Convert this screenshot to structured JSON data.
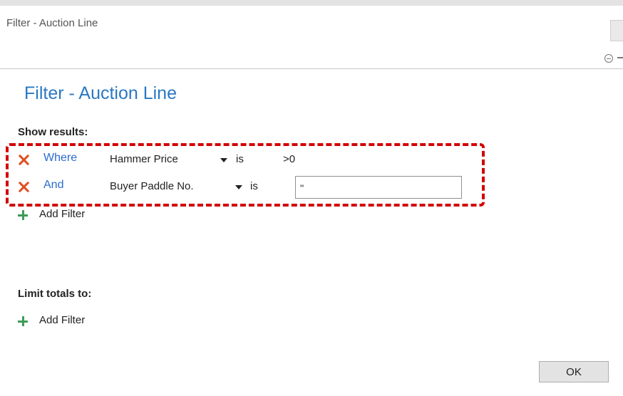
{
  "window": {
    "title": "Filter - Auction Line"
  },
  "page": {
    "title": "Filter - Auction Line"
  },
  "show_results": {
    "heading": "Show results:",
    "filters": [
      {
        "connector": "Where",
        "field": "Hammer Price",
        "operator": "is",
        "value": ">0"
      },
      {
        "connector": "And",
        "field": "Buyer Paddle No.",
        "operator": "is",
        "value": "''"
      }
    ],
    "add_filter_label": "Add Filter"
  },
  "limit_totals": {
    "heading": "Limit totals to:",
    "add_filter_label": "Add Filter"
  },
  "actions": {
    "ok_label": "OK"
  },
  "icons": {
    "remove": "remove-filter-x-icon",
    "add": "plus-icon",
    "dropdown": "dropdown-arrow-icon",
    "collapse": "collapse-icon"
  },
  "colors": {
    "title_blue": "#2a78c4",
    "connector_blue": "#2a6bcf",
    "remove_orange": "#e04e1f",
    "add_green": "#3f9b57",
    "highlight_red": "#d10000"
  }
}
